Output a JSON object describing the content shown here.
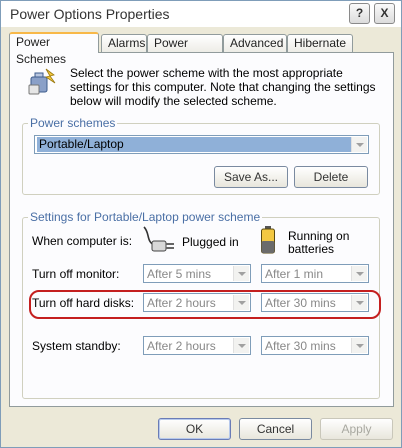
{
  "window": {
    "title": "Power Options Properties",
    "help_label": "?",
    "close_label": "X"
  },
  "tabs": [
    {
      "label": "Power Schemes",
      "active": true
    },
    {
      "label": "Alarms"
    },
    {
      "label": "Power Meter"
    },
    {
      "label": "Advanced"
    },
    {
      "label": "Hibernate"
    }
  ],
  "intro": "Select the power scheme with the most appropriate settings for this computer. Note that changing the settings below will modify the selected scheme.",
  "schemes": {
    "group_label": "Power schemes",
    "selected": "Portable/Laptop",
    "save_as_label": "Save As...",
    "delete_label": "Delete"
  },
  "settings": {
    "group_label": "Settings for Portable/Laptop power scheme",
    "when_label": "When computer is:",
    "plugged_label": "Plugged in",
    "batteries_label": "Running on\nbatteries",
    "rows": [
      {
        "label": "Turn off monitor:",
        "plugged": "After 5 mins",
        "batteries": "After 1 min"
      },
      {
        "label": "Turn off hard disks:",
        "plugged": "After 2 hours",
        "batteries": "After 30 mins"
      },
      {
        "label": "System standby:",
        "plugged": "After 2 hours",
        "batteries": "After 30 mins"
      }
    ]
  },
  "footer": {
    "ok_label": "OK",
    "cancel_label": "Cancel",
    "apply_label": "Apply"
  },
  "colors": {
    "highlight": "#c41f1f",
    "tab_accent": "#f8b848",
    "selection": "#8fb0d8"
  }
}
